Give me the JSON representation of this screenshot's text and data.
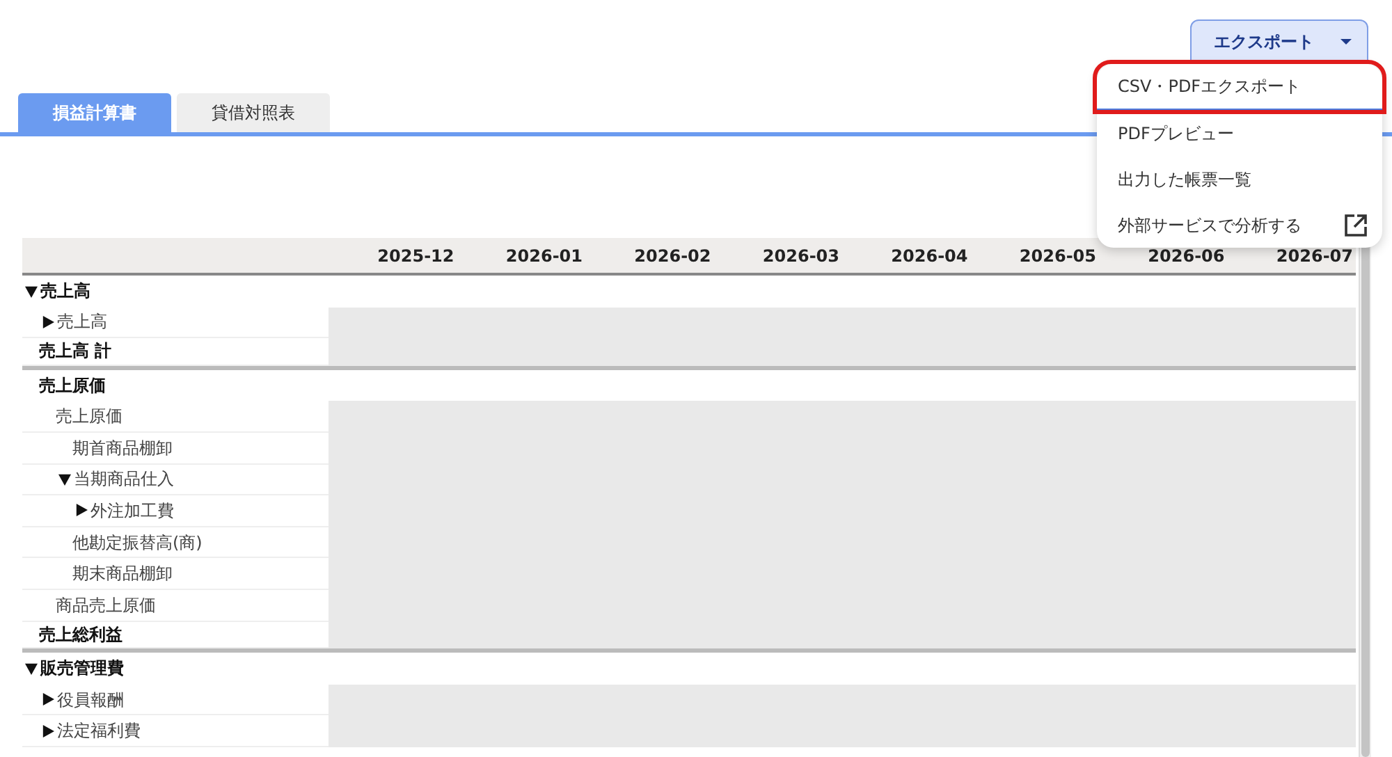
{
  "export_button": {
    "label": "エクスポート",
    "expanded": true
  },
  "export_menu": [
    {
      "label": "CSV・PDFエクスポート",
      "selected": true
    },
    {
      "label": "PDFプレビュー",
      "selected": false
    },
    {
      "label": "出力した帳票一覧",
      "selected": false
    },
    {
      "label": "外部サービスで分析する",
      "selected": false,
      "external": true
    }
  ],
  "tabs": [
    {
      "label": "損益計算書",
      "selected": true
    },
    {
      "label": "貸借対照表",
      "selected": false
    }
  ],
  "table": {
    "columns": [
      "2025-12",
      "2026-01",
      "2026-02",
      "2026-03",
      "2026-04",
      "2026-05",
      "2026-06",
      "2026-07"
    ],
    "rows": [
      {
        "label": "売上高",
        "kind": "header",
        "expanded": true,
        "children": [
          {
            "label": "売上高",
            "kind": "item",
            "expanded": false
          }
        ]
      },
      {
        "label": "売上高 計",
        "kind": "total"
      },
      {
        "label": "売上原価",
        "kind": "header",
        "children": [
          {
            "label": "売上原価",
            "kind": "item",
            "children": [
              {
                "label": "期首商品棚卸",
                "kind": "item"
              },
              {
                "label": "当期商品仕入",
                "kind": "item",
                "expanded": true,
                "children": [
                  {
                    "label": "外注加工費",
                    "kind": "item",
                    "expanded": false
                  }
                ]
              },
              {
                "label": "他勘定振替高(商)",
                "kind": "item"
              },
              {
                "label": "期末商品棚卸",
                "kind": "item"
              }
            ]
          },
          {
            "label": "商品売上原価",
            "kind": "item"
          }
        ]
      },
      {
        "label": "売上総利益",
        "kind": "total"
      },
      {
        "label": "販売管理費",
        "kind": "header",
        "expanded": true,
        "children": [
          {
            "label": "役員報酬",
            "kind": "item",
            "expanded": false
          },
          {
            "label": "法定福利費",
            "kind": "item",
            "expanded": false
          }
        ]
      }
    ]
  }
}
